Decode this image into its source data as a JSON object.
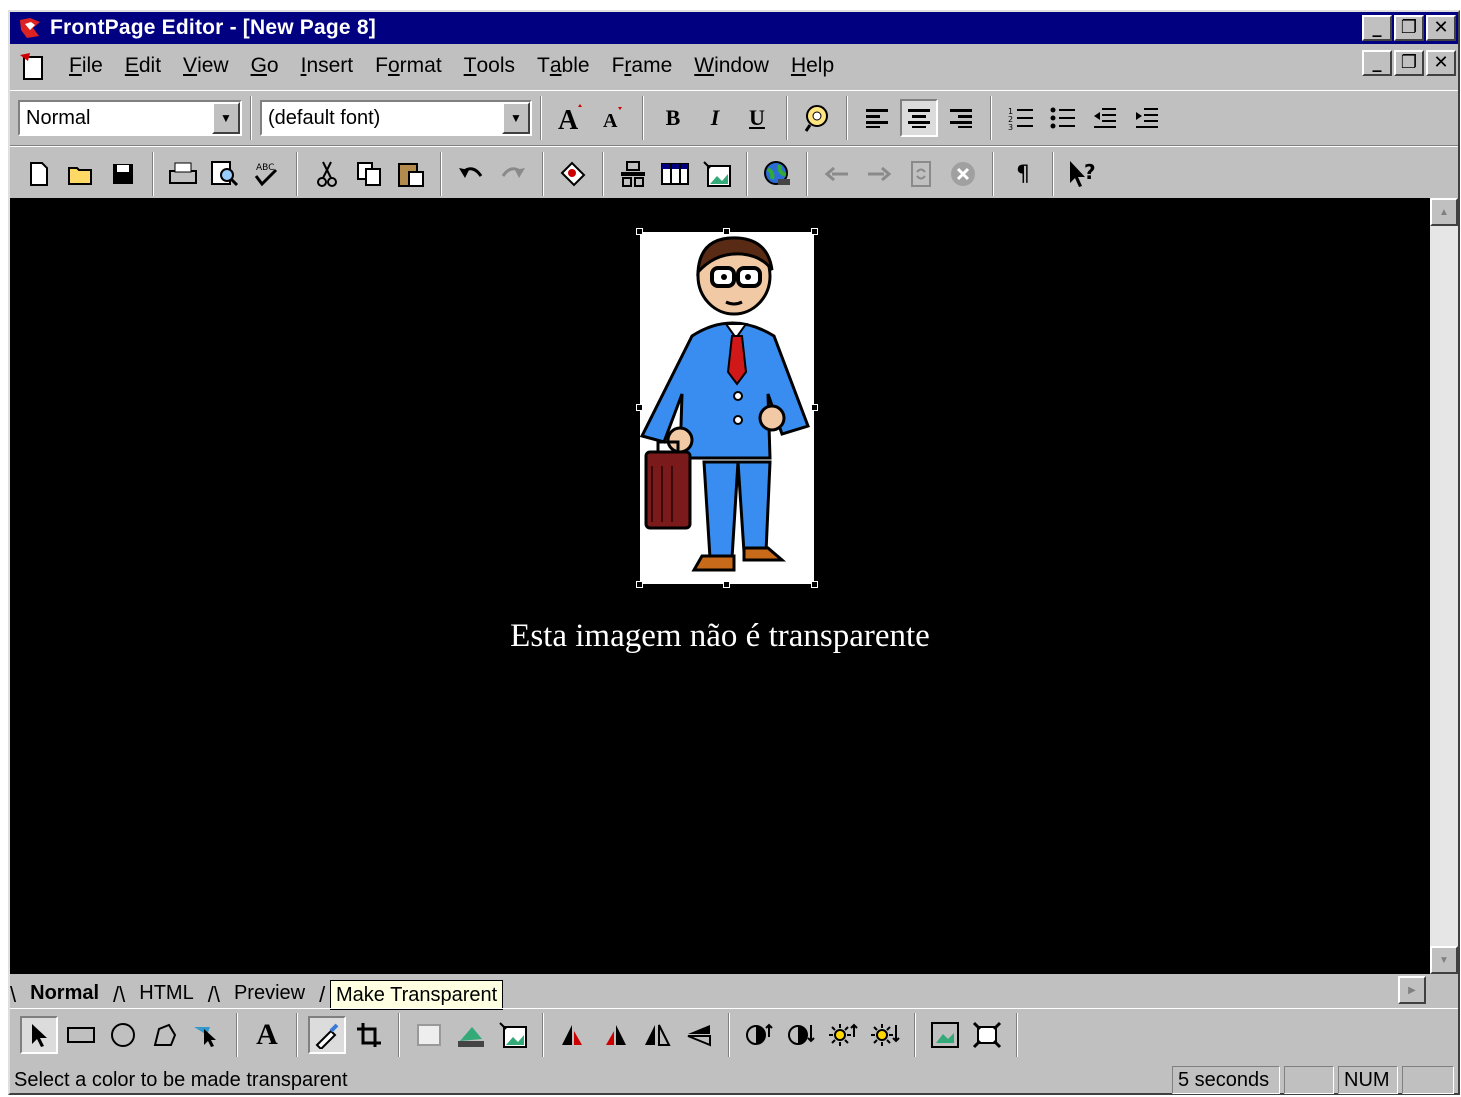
{
  "window": {
    "title": "FrontPage Editor - [New Page 8]"
  },
  "title_buttons": {
    "minimize": "_",
    "restore": "❐",
    "close": "✕"
  },
  "menu": [
    {
      "label": "File",
      "pre": "",
      "acc": "F",
      "post": "ile"
    },
    {
      "label": "Edit",
      "pre": "",
      "acc": "E",
      "post": "dit"
    },
    {
      "label": "View",
      "pre": "",
      "acc": "V",
      "post": "iew"
    },
    {
      "label": "Go",
      "pre": "",
      "acc": "G",
      "post": "o"
    },
    {
      "label": "Insert",
      "pre": "",
      "acc": "I",
      "post": "nsert"
    },
    {
      "label": "Format",
      "pre": "F",
      "acc": "o",
      "post": "rmat"
    },
    {
      "label": "Tools",
      "pre": "",
      "acc": "T",
      "post": "ools"
    },
    {
      "label": "Table",
      "pre": "T",
      "acc": "a",
      "post": "ble"
    },
    {
      "label": "Frame",
      "pre": "F",
      "acc": "r",
      "post": "ame"
    },
    {
      "label": "Window",
      "pre": "",
      "acc": "W",
      "post": "indow"
    },
    {
      "label": "Help",
      "pre": "",
      "acc": "H",
      "post": "elp"
    }
  ],
  "format_toolbar": {
    "style": "Normal",
    "font": "(default font)",
    "bold": "B",
    "italic": "I",
    "underline": "U"
  },
  "editor": {
    "caption": "Esta imagem não é transparente",
    "background": "#000000"
  },
  "view_tabs": [
    {
      "label": "Normal",
      "active": true
    },
    {
      "label": "HTML",
      "active": false
    },
    {
      "label": "Preview",
      "active": false
    }
  ],
  "tooltip": "Make Transparent",
  "status": {
    "message": "Select a color to be made transparent",
    "download_time": "5 seconds",
    "num_lock": "NUM"
  },
  "icons": {
    "standard": [
      "new-icon",
      "open-icon",
      "save-icon",
      "print-icon",
      "print-preview-icon",
      "spelling-icon",
      "cut-icon",
      "copy-icon",
      "paste-icon",
      "undo-icon",
      "redo-icon",
      "webbot-icon",
      "form-field-icon",
      "table-icon",
      "image-icon",
      "hyperlink-icon",
      "back-icon",
      "forward-icon",
      "refresh-icon",
      "stop-icon",
      "show-all-icon",
      "help-icon"
    ],
    "image_tools": [
      "select-icon",
      "rectangle-icon",
      "circle-icon",
      "polygon-icon",
      "highlight-hotspots-icon",
      "text-icon",
      "make-transparent-icon",
      "crop-icon"
    ]
  }
}
